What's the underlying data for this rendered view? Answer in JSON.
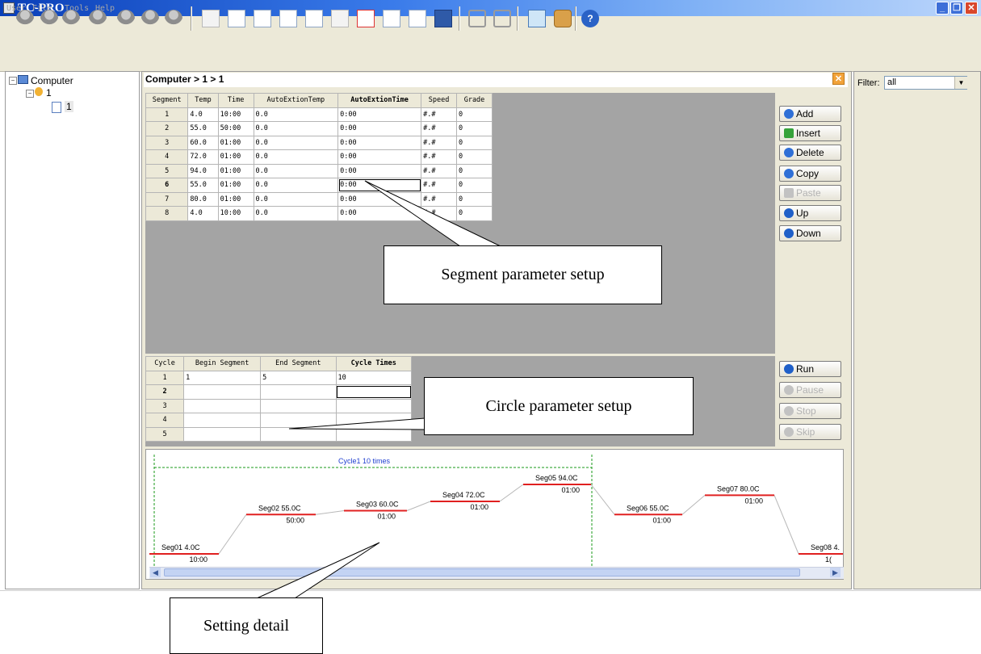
{
  "window": {
    "title": "TC-PRO"
  },
  "menu": [
    "User",
    "File",
    "Tools",
    "Help"
  ],
  "tree": {
    "root": "Computer",
    "user": "1",
    "file": "1"
  },
  "breadcrumb": "Computer > 1 > 1",
  "segments": {
    "headers": [
      "Segment",
      "Temp",
      "Time",
      "AutoExtionTemp",
      "AutoExtionTime",
      "Speed",
      "Grade"
    ],
    "rows": [
      [
        "1",
        "4.0",
        "10:00",
        "0.0",
        "0:00",
        "#.#",
        "0"
      ],
      [
        "2",
        "55.0",
        "50:00",
        "0.0",
        "0:00",
        "#.#",
        "0"
      ],
      [
        "3",
        "60.0",
        "01:00",
        "0.0",
        "0:00",
        "#.#",
        "0"
      ],
      [
        "4",
        "72.0",
        "01:00",
        "0.0",
        "0:00",
        "#.#",
        "0"
      ],
      [
        "5",
        "94.0",
        "01:00",
        "0.0",
        "0:00",
        "#.#",
        "0"
      ],
      [
        "6",
        "55.0",
        "01:00",
        "0.0",
        "0:00",
        "#.#",
        "0"
      ],
      [
        "7",
        "80.0",
        "01:00",
        "0.0",
        "0:00",
        "#.#",
        "0"
      ],
      [
        "8",
        "4.0",
        "10:00",
        "0.0",
        "0:00",
        "#.#",
        "0"
      ]
    ]
  },
  "cycles": {
    "headers": [
      "Cycle",
      "Begin Segment",
      "End Segment",
      "Cycle Times"
    ],
    "rows": [
      [
        "1",
        "1",
        "5",
        "10"
      ],
      [
        "2",
        "",
        "",
        ""
      ],
      [
        "3",
        "",
        "",
        ""
      ],
      [
        "4",
        "",
        "",
        ""
      ],
      [
        "5",
        "",
        "",
        ""
      ]
    ]
  },
  "edit_buttons": [
    "Add",
    "Insert",
    "Delete",
    "Copy",
    "Paste",
    "Up",
    "Down"
  ],
  "run_buttons": [
    "Run",
    "Pause",
    "Stop",
    "Skip"
  ],
  "filter": {
    "label": "Filter:",
    "value": "all"
  },
  "profile": {
    "cycle_label": "Cycle1  10 times",
    "segments": [
      {
        "name": "Seg01",
        "temp": "4.0C",
        "time": "10:00"
      },
      {
        "name": "Seg02",
        "temp": "55.0C",
        "time": "50:00"
      },
      {
        "name": "Seg03",
        "temp": "60.0C",
        "time": "01:00"
      },
      {
        "name": "Seg04",
        "temp": "72.0C",
        "time": "01:00"
      },
      {
        "name": "Seg05",
        "temp": "94.0C",
        "time": "01:00"
      },
      {
        "name": "Seg06",
        "temp": "55.0C",
        "time": "01:00"
      },
      {
        "name": "Seg07",
        "temp": "80.0C",
        "time": "01:00"
      },
      {
        "name": "Seg08",
        "temp": "4.",
        "time": "1("
      }
    ]
  },
  "annotations": {
    "segment": "Segment parameter setup",
    "cycle": "Circle parameter setup",
    "detail": "Setting detail"
  },
  "colors": {
    "profile_line": "#e02020",
    "cycle_frame": "#1a9a1a",
    "titlebar": "#0a3fb8"
  }
}
